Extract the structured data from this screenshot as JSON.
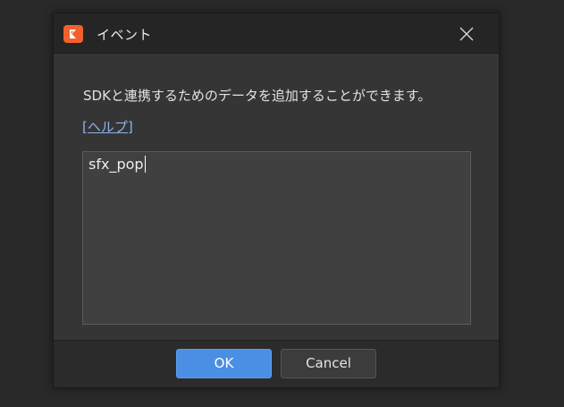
{
  "dialog": {
    "title": "イベント",
    "description": "SDKと連携するためのデータを追加することができます。",
    "help_link": "[ヘルプ]",
    "textarea_value": "sfx_pop",
    "ok_label": "OK",
    "cancel_label": "Cancel"
  },
  "icons": {
    "app": "app-logo-icon",
    "close": "close-icon"
  },
  "colors": {
    "accent": "#4a8fe4",
    "logo": "#f2612d",
    "link": "#8fb2e6"
  }
}
